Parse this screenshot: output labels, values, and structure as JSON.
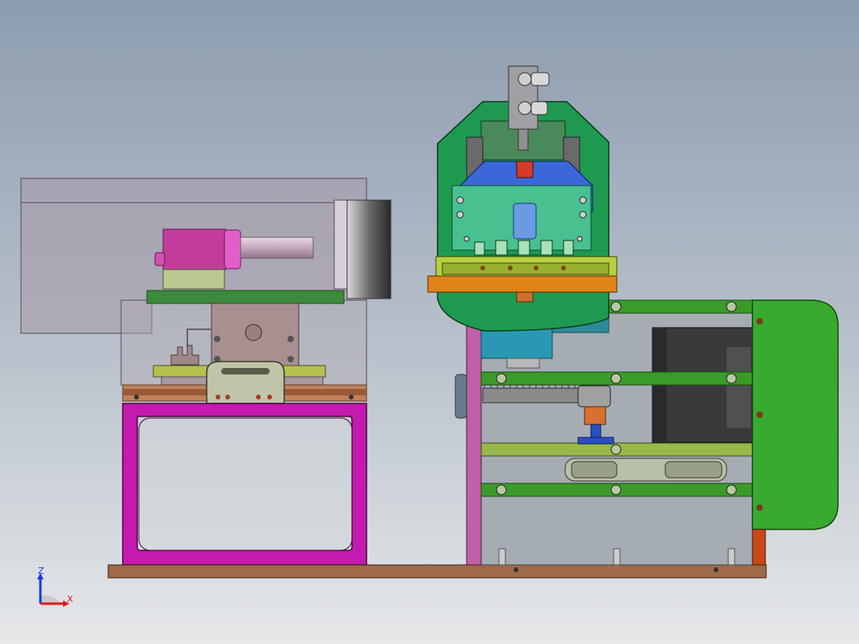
{
  "triad": {
    "z_label": "Z",
    "x_label": "X"
  },
  "colors": {
    "bg_top": "#8e9db0",
    "bg_bottom": "#e4e7ea",
    "magenta": "#c020a8",
    "green": "#38a832",
    "bright_green": "#3aaa2a",
    "orange": "#d87818",
    "brown": "#9a6a4a",
    "gray": "#8a8a8a",
    "blue": "#3a6ad8",
    "teal": "#2898b8"
  }
}
